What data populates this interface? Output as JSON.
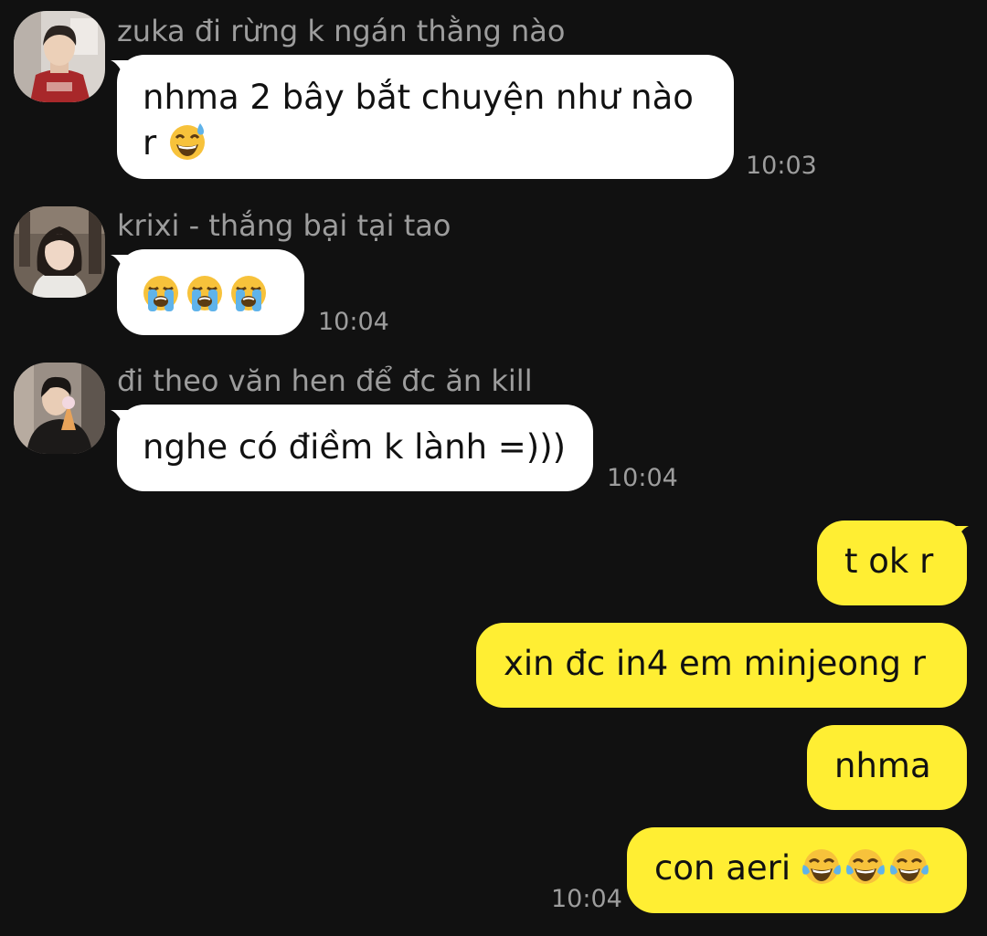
{
  "messages": [
    {
      "sender": "zuka đi rừng k ngán thằng nào",
      "text_line1": "nhma 2 bây bắt chuyện như nào",
      "text_line2": "r",
      "emoji": "grinning-sweat-emoji",
      "time": "10:03"
    },
    {
      "sender": "krixi - thắng bại tại tao",
      "emoji": "loudly-crying-emoji",
      "emoji_count": 3,
      "time": "10:04"
    },
    {
      "sender": "đi theo văn hen để đc ăn kill",
      "text": "nghe có điềm k lành =)))",
      "time": "10:04"
    }
  ],
  "outgoing": [
    {
      "text": "t ok r"
    },
    {
      "text": "xin đc in4 em minjeong r"
    },
    {
      "text": "nhma"
    },
    {
      "text": "con aeri",
      "emoji": "tears-of-joy-emoji",
      "emoji_count": 3
    }
  ],
  "outgoing_time": "10:04",
  "colors": {
    "background": "#111111",
    "incoming_bubble": "#ffffff",
    "outgoing_bubble": "#ffee33",
    "meta_text": "#9d9d9d"
  }
}
